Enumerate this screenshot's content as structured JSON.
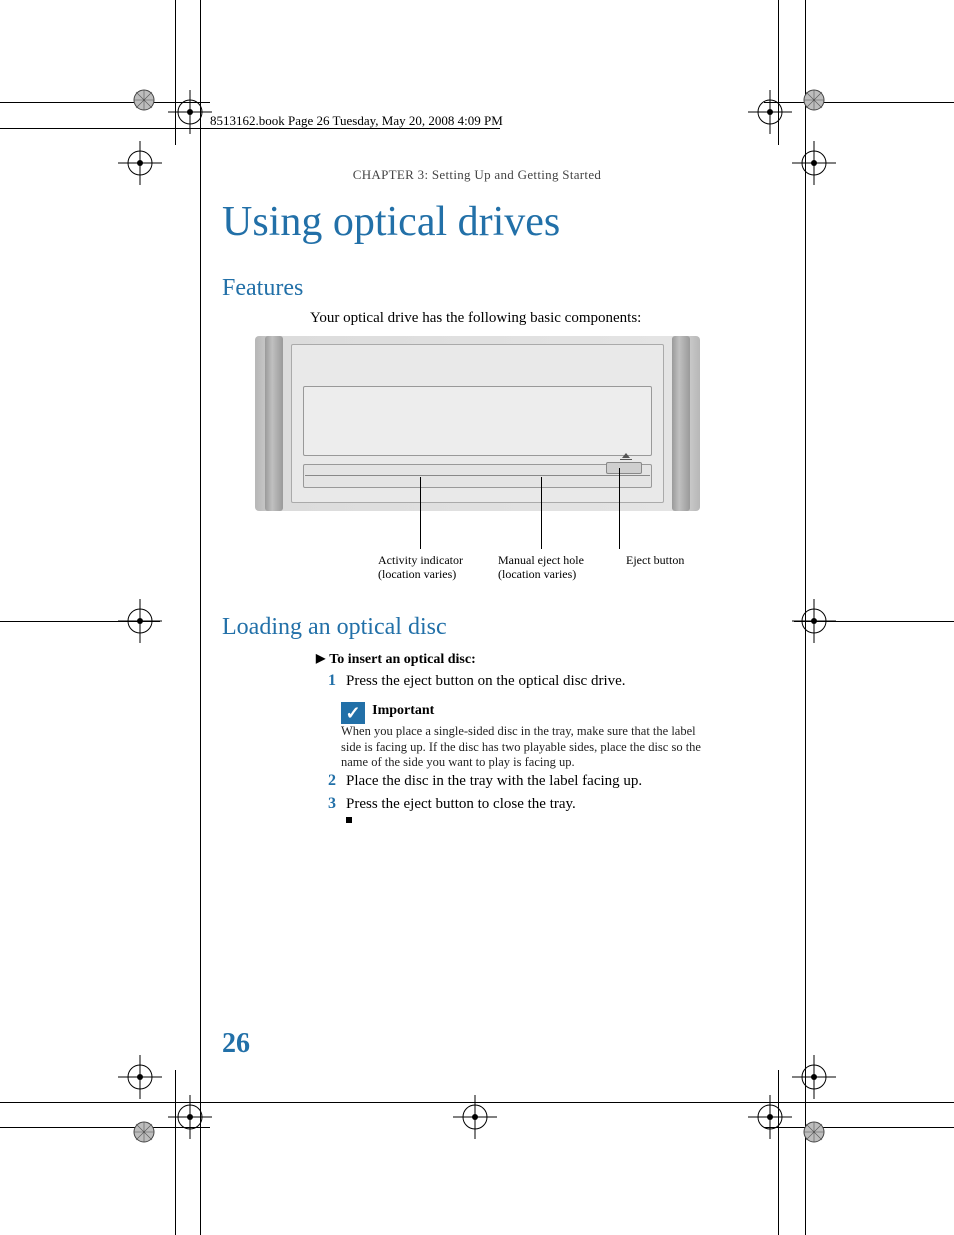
{
  "header": {
    "file_line": "8513162.book  Page 26  Tuesday, May 20, 2008  4:09 PM",
    "chapter": "CHAPTER 3: Setting Up and Getting Started"
  },
  "h1": "Using optical drives",
  "features": {
    "heading": "Features",
    "intro": "Your optical drive has the following basic components:"
  },
  "diagram": {
    "labels": {
      "activity_line1": "Activity indicator",
      "activity_line2": "(location varies)",
      "manual_line1": "Manual eject hole",
      "manual_line2": "(location varies)",
      "eject": "Eject button"
    }
  },
  "loading": {
    "heading": "Loading an optical disc",
    "task_lead": "To insert an optical disc:",
    "steps": {
      "s1_num": "1",
      "s1_text": "Press the eject button on the optical disc drive.",
      "s2_num": "2",
      "s2_text": "Place the disc in the tray with the label facing up.",
      "s3_num": "3",
      "s3_text": "Press the eject button to close the tray."
    }
  },
  "important": {
    "title": "Important",
    "body": "When you place a single-sided disc in the tray, make sure that the label side is facing up. If the disc has two playable sides, place the disc so the name of the side you want to play is facing up."
  },
  "page_number": "26"
}
